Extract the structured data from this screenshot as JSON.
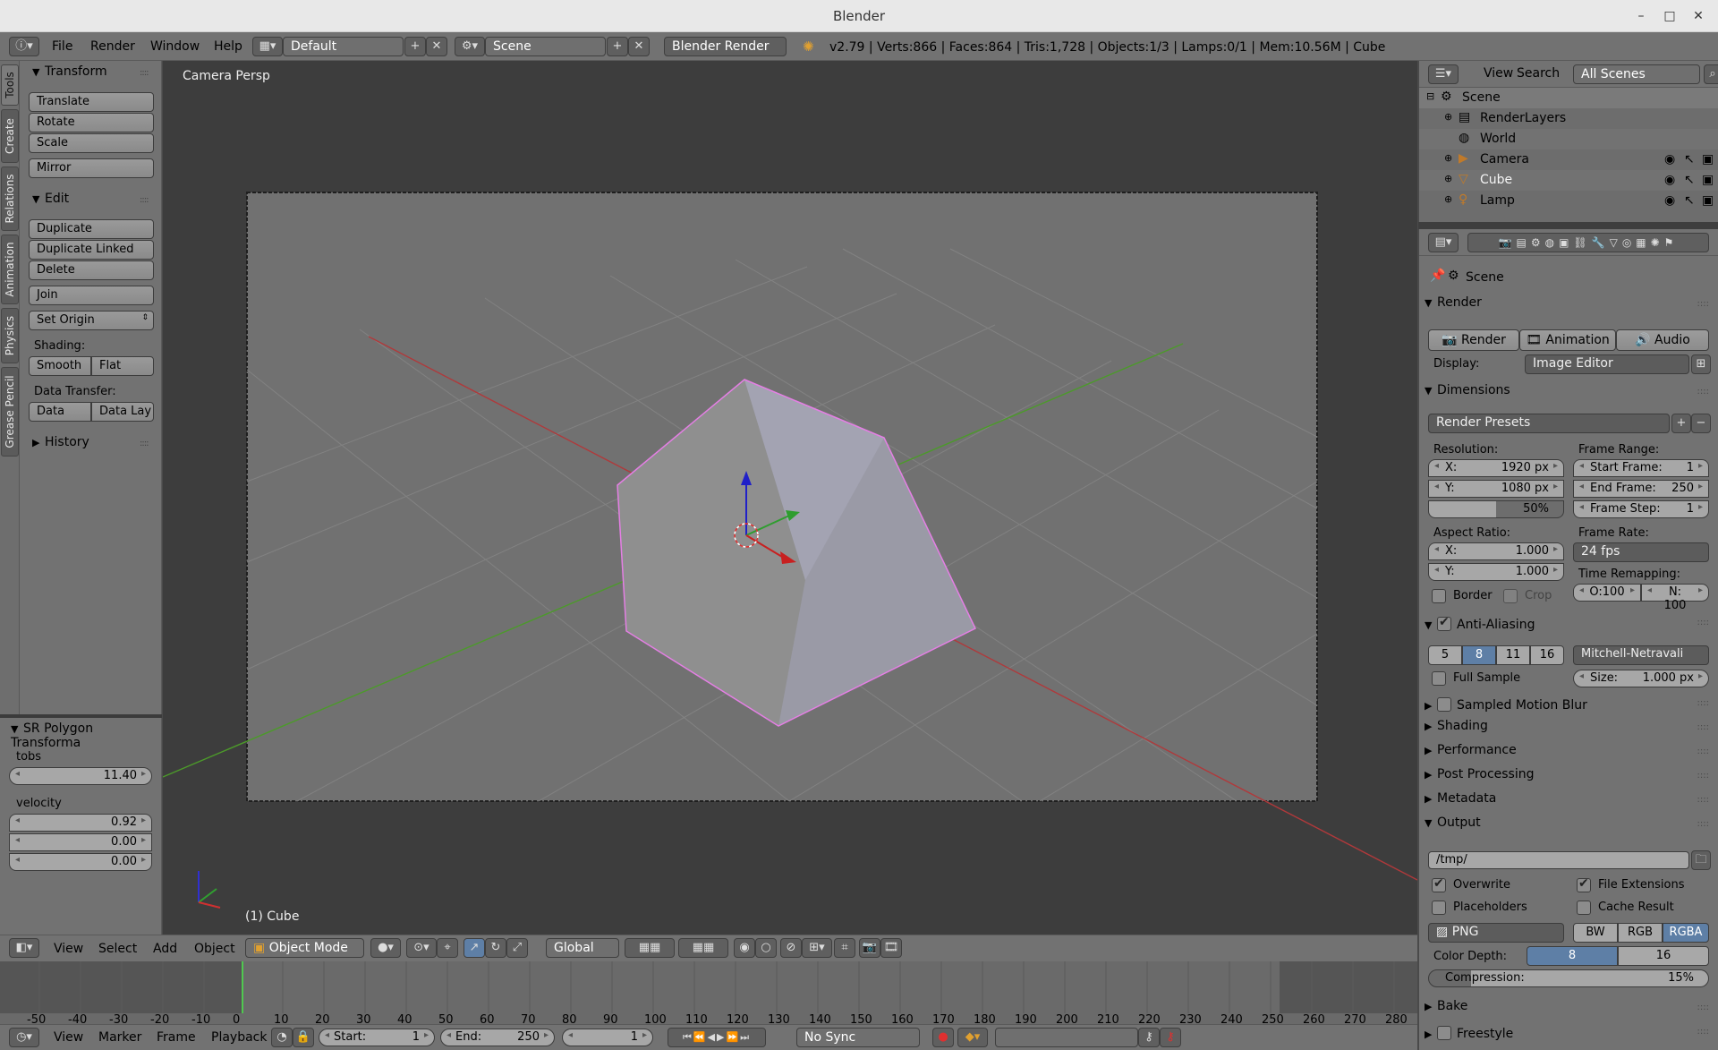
{
  "window": {
    "title": "Blender"
  },
  "topbar": {
    "menus": [
      "File",
      "Render",
      "Window",
      "Help"
    ],
    "layout": "Default",
    "scene": "Scene",
    "engine": "Blender Render",
    "stats": "v2.79 | Verts:866 | Faces:864 | Tris:1,728 | Objects:1/3 | Lamps:0/1 | Mem:10.56M | Cube"
  },
  "tabs": [
    "Tools",
    "Create",
    "Relations",
    "Animation",
    "Physics",
    "Grease Pencil"
  ],
  "toolshelf": {
    "transform": {
      "title": "Transform",
      "buttons": [
        "Translate",
        "Rotate",
        "Scale",
        "Mirror"
      ]
    },
    "edit": {
      "title": "Edit",
      "buttons": [
        "Duplicate",
        "Duplicate Linked",
        "Delete",
        "Join"
      ],
      "set_origin": "Set Origin",
      "shading_label": "Shading:",
      "smooth": "Smooth",
      "flat": "Flat",
      "transfer_label": "Data Transfer:",
      "data": "Data",
      "data_lay": "Data Lay"
    },
    "history": "History"
  },
  "redo": {
    "title": "SR Polygon Transforma",
    "tobs_label": "tobs",
    "tobs": "11.40",
    "velocity_label": "velocity",
    "v1": "0.92",
    "v2": "0.00",
    "v3": "0.00"
  },
  "viewport": {
    "persp": "Camera Persp",
    "object": "(1) Cube"
  },
  "header3d": {
    "menus": [
      "View",
      "Select",
      "Add",
      "Object"
    ],
    "mode": "Object Mode",
    "orientation": "Global"
  },
  "timeline": {
    "ticks": [
      "-50",
      "-40",
      "-30",
      "-20",
      "-10",
      "0",
      "10",
      "20",
      "30",
      "40",
      "50",
      "60",
      "70",
      "80",
      "90",
      "100",
      "110",
      "120",
      "130",
      "140",
      "150",
      "160",
      "170",
      "180",
      "190",
      "200",
      "210",
      "220",
      "230",
      "240",
      "250",
      "260",
      "270",
      "280"
    ]
  },
  "tlheader": {
    "menus": [
      "View",
      "Marker",
      "Frame",
      "Playback"
    ],
    "start_label": "Start:",
    "start": "1",
    "end_label": "End:",
    "end": "250",
    "current": "1",
    "sync": "No Sync"
  },
  "outliner": {
    "menus": [
      "View",
      "Search"
    ],
    "filter": "All Scenes",
    "rows": [
      "Scene",
      "RenderLayers",
      "World",
      "Camera",
      "Cube",
      "Lamp"
    ]
  },
  "properties": {
    "context": "Scene",
    "render": {
      "title": "Render",
      "render_btn": "Render",
      "anim_btn": "Animation",
      "audio_btn": "Audio",
      "display_label": "Display:",
      "display": "Image Editor"
    },
    "dimensions": {
      "title": "Dimensions",
      "presets": "Render Presets",
      "res_label": "Resolution:",
      "rx_label": "X:",
      "rx": "1920 px",
      "ry_label": "Y:",
      "ry": "1080 px",
      "pct": "50%",
      "range_label": "Frame Range:",
      "start_label": "Start Frame:",
      "start": "1",
      "end_label": "End Frame:",
      "end": "250",
      "step_label": "Frame Step:",
      "step": "1",
      "aspect_label": "Aspect Ratio:",
      "ax_label": "X:",
      "ax": "1.000",
      "ay_label": "Y:",
      "ay": "1.000",
      "rate_label": "Frame Rate:",
      "rate": "24 fps",
      "remap_label": "Time Remapping:",
      "old": "O:100",
      "new": "N: 100",
      "border": "Border",
      "crop": "Crop"
    },
    "aa": {
      "title": "Anti-Aliasing",
      "samples": [
        "5",
        "8",
        "11",
        "16"
      ],
      "filter": "Mitchell-Netravali",
      "full": "Full Sample",
      "size_label": "Size:",
      "size": "1.000 px"
    },
    "collapsed": [
      "Sampled Motion Blur",
      "Shading",
      "Performance",
      "Post Processing",
      "Metadata"
    ],
    "output": {
      "title": "Output",
      "path": "/tmp/",
      "overwrite": "Overwrite",
      "file_ext": "File Extensions",
      "placeholders": "Placeholders",
      "cache": "Cache Result",
      "format": "PNG",
      "bw": "BW",
      "rgb": "RGB",
      "rgba": "RGBA",
      "depth_label": "Color Depth:",
      "d8": "8",
      "d16": "16",
      "compression_label": "Compression:",
      "compression": "15%"
    },
    "bake": "Bake",
    "freestyle": "Freestyle"
  },
  "colors": {
    "accent": "#5e7fa6",
    "selection_outline": "#e47fe4",
    "x_axis": "#b0393b",
    "y_axis": "#4c9a2a"
  }
}
